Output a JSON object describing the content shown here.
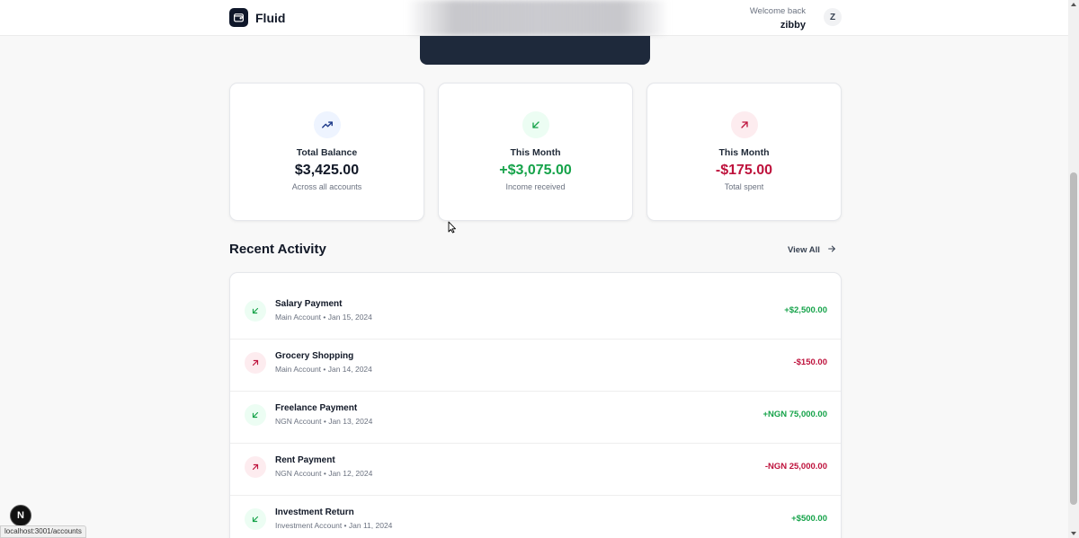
{
  "header": {
    "app_name": "Fluid",
    "welcome": "Welcome back",
    "username": "zibby",
    "avatar_initial": "Z",
    "logo_icon": "wallet-icon"
  },
  "stats": [
    {
      "title": "Total Balance",
      "value": "$3,425.00",
      "sub": "Across all accounts",
      "icon": "trending-up-icon",
      "tone": "neutral",
      "color": "#111827"
    },
    {
      "title": "This Month",
      "value": "+$3,075.00",
      "sub": "Income received",
      "icon": "arrow-down-left-icon",
      "tone": "positive",
      "color": "#16a34a"
    },
    {
      "title": "This Month",
      "value": "-$175.00",
      "sub": "Total spent",
      "icon": "arrow-up-right-icon",
      "tone": "negative",
      "color": "#be123c"
    }
  ],
  "recent": {
    "title": "Recent Activity",
    "view_all": "View All",
    "items": [
      {
        "name": "Salary Payment",
        "meta": "Main Account • Jan 15, 2024",
        "amount": "+$2,500.00",
        "type": "income"
      },
      {
        "name": "Grocery Shopping",
        "meta": "Main Account • Jan 14, 2024",
        "amount": "-$150.00",
        "type": "expense"
      },
      {
        "name": "Freelance Payment",
        "meta": "NGN Account • Jan 13, 2024",
        "amount": "+NGN 75,000.00",
        "type": "income"
      },
      {
        "name": "Rent Payment",
        "meta": "NGN Account • Jan 12, 2024",
        "amount": "-NGN 25,000.00",
        "type": "expense"
      },
      {
        "name": "Investment Return",
        "meta": "Investment Account • Jan 11, 2024",
        "amount": "+$500.00",
        "type": "income"
      }
    ]
  },
  "overlays": {
    "next_badge": "N",
    "status_url": "localhost:3001/accounts"
  },
  "colors": {
    "positive": "#16a34a",
    "negative": "#be123c",
    "brand_dark": "#0f172a"
  }
}
